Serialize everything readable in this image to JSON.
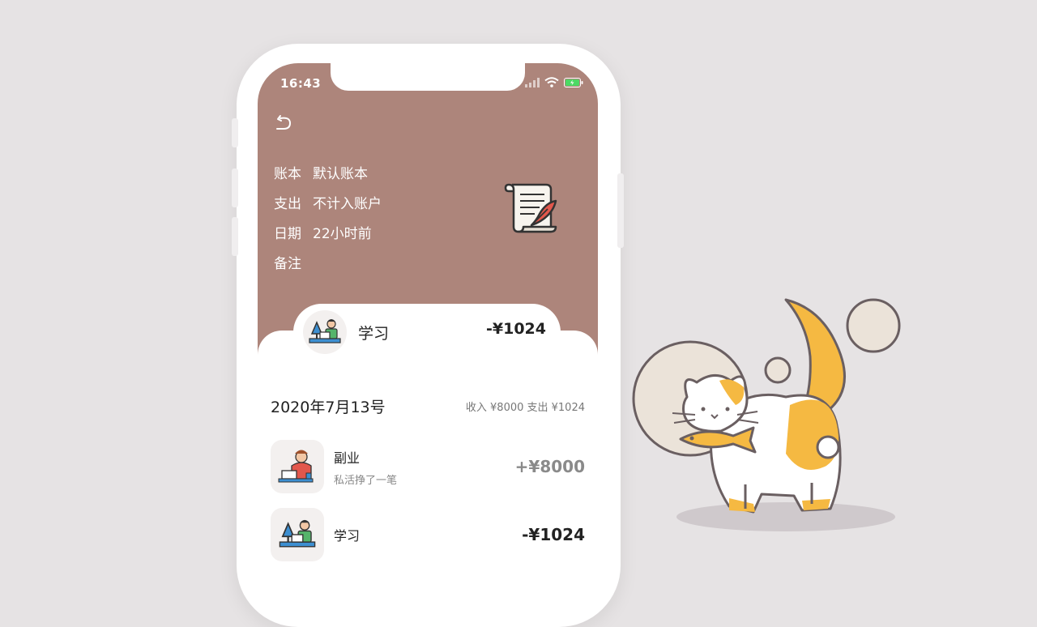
{
  "status_bar": {
    "time": "16:43"
  },
  "record": {
    "fields": [
      {
        "key": "账本",
        "value": "默认账本"
      },
      {
        "key": "支出",
        "value": "不计入账户"
      },
      {
        "key": "日期",
        "value": "22小时前"
      },
      {
        "key": "备注",
        "value": ""
      }
    ],
    "category": "学习",
    "amount": "-¥1024"
  },
  "day": {
    "date": "2020年7月13号",
    "summary": "收入 ¥8000  支出 ¥1024"
  },
  "transactions": [
    {
      "title": "副业",
      "note": "私活挣了一笔",
      "amount": "+¥8000",
      "icon": "freelancer-icon"
    },
    {
      "title": "学习",
      "note": "",
      "amount": "-¥1024",
      "icon": "study-icon"
    }
  ],
  "colors": {
    "header": "#ad857b",
    "background": "#e6e3e4",
    "accent": "#f5b942"
  }
}
